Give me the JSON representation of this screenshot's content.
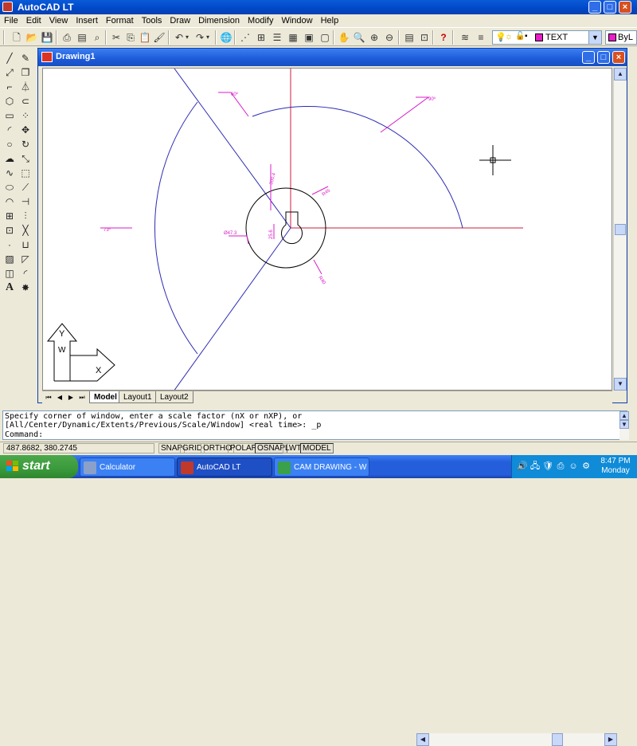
{
  "app": {
    "title": "AutoCAD LT"
  },
  "caption_buttons": {
    "minimize": "_",
    "maximize": "□",
    "close": "×"
  },
  "menu": [
    "File",
    "Edit",
    "View",
    "Insert",
    "Format",
    "Tools",
    "Draw",
    "Dimension",
    "Modify",
    "Window",
    "Help"
  ],
  "toolbar": {
    "icons": [
      "new-file-icon",
      "open-file-icon",
      "save-icon",
      "print-icon",
      "print-preview-icon",
      "find-icon",
      "cut-icon",
      "copy-icon",
      "paste-icon",
      "match-properties-icon",
      "undo-icon",
      "redo-icon",
      "globe-icon",
      "snap-from-icon",
      "insert-block-icon",
      "layers-properties-icon",
      "design-center-icon",
      "tool-palette-icon",
      "pan-icon",
      "zoom-realtime-icon",
      "zoom-window-icon",
      "zoom-previous-icon",
      "distance-icon",
      "help-icon",
      "layer-manager-icon",
      "layer-previous-icon"
    ],
    "layer_name": "TEXT",
    "layer_color": "#e81ec8",
    "color_value": "ByL"
  },
  "left_tools": [
    "line-icon",
    "construction-line-icon",
    "polyline-icon",
    "polygon-icon",
    "rectangle-icon",
    "arc-icon",
    "circle-icon",
    "revision-cloud-icon",
    "spline-icon",
    "ellipse-icon",
    "ellipse-arc-icon",
    "insert-block-icon",
    "make-block-icon",
    "point-icon",
    "hatch-icon",
    "region-icon",
    "text-icon",
    "erase-icon",
    "copy-object-icon",
    "mirror-icon",
    "offset-icon",
    "array-icon",
    "move-icon",
    "rotate-icon",
    "scale-icon",
    "stretch-icon",
    "trim-icon",
    "extend-icon",
    "break-icon",
    "break-at-point-icon",
    "join-icon",
    "chamfer-icon",
    "fillet-icon",
    "explode-icon"
  ],
  "drawing": {
    "title": "Drawing1",
    "labels": {
      "deg_top_left": "60º",
      "deg_top_right": "90º",
      "deg_left": "73º",
      "dim_300": "300.4",
      "dim_r45": "R45",
      "dim_947": "Ø47.3",
      "dim_256": "25.6",
      "dim_r40": "R40"
    },
    "colors": {
      "curve": "#2b2bb4",
      "axis": "#c81e3c",
      "dimension": "#d81ec8",
      "object": "#000000"
    }
  },
  "tabs": [
    {
      "label": "Model",
      "active": true
    },
    {
      "label": "Layout1",
      "active": false
    },
    {
      "label": "Layout2",
      "active": false
    }
  ],
  "ucs": {
    "x": "X",
    "y": "Y",
    "w": "W"
  },
  "command": {
    "line1": "Specify corner of window, enter a scale factor (nX or nXP), or",
    "line2": "[All/Center/Dynamic/Extents/Previous/Scale/Window] <real time>: _p",
    "prompt": "Command:"
  },
  "status": {
    "coords": "487.8682, 380.2745",
    "toggles": [
      {
        "label": "SNAP",
        "on": false
      },
      {
        "label": "GRID",
        "on": false
      },
      {
        "label": "ORTHO",
        "on": false
      },
      {
        "label": "POLAR",
        "on": false
      },
      {
        "label": "OSNAP",
        "on": true
      },
      {
        "label": "LWT",
        "on": false
      },
      {
        "label": "MODEL",
        "on": true
      }
    ]
  },
  "taskbar": {
    "start": "start",
    "items": [
      {
        "label": "Calculator",
        "active": false,
        "icon_color": "#8aa0c8"
      },
      {
        "label": "AutoCAD LT",
        "active": true,
        "icon_color": "#c0392b"
      },
      {
        "label": "CAM DRAWING - Wi...",
        "active": false,
        "icon_color": "#3aa04a"
      }
    ],
    "time": "8:47 PM",
    "day": "Monday"
  }
}
